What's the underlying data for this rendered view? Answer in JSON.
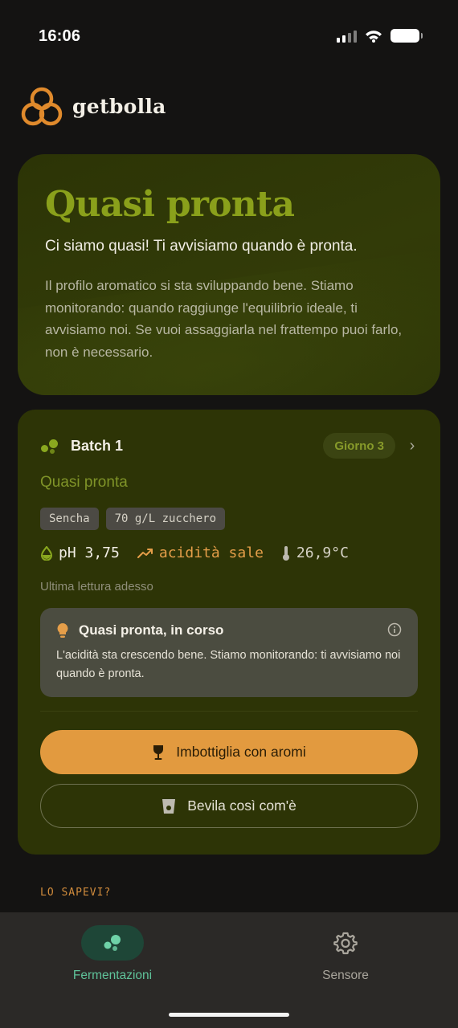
{
  "status_bar": {
    "time": "16:06"
  },
  "brand": {
    "name": "getbolla"
  },
  "hero": {
    "title": "Quasi pronta",
    "subtitle": "Ci siamo quasi! Ti avvisiamo quando è pronta.",
    "body": "Il profilo aromatico si sta sviluppando bene. Stiamo monitorando: quando raggiunge l'equilibrio ideale, ti avvisiamo noi. Se vuoi assaggiarla nel frattempo puoi farlo, non è necessario."
  },
  "batch": {
    "title": "Batch 1",
    "day": "Giorno 3",
    "status": "Quasi pronta",
    "chips": [
      "Sencha",
      "70 g/L zucchero"
    ],
    "readings": {
      "ph": "pH 3,75",
      "acidity": "acidità sale",
      "temperature": "26,9°C"
    },
    "last_reading": "Ultima lettura adesso",
    "insight": {
      "title": "Quasi pronta, in corso",
      "body": "L'acidità sta crescendo bene. Stiamo monitorando: ti avvisiamo noi quando è pronta."
    },
    "primary_action": "Imbottiglia con aromi",
    "secondary_action": "Bevila così com'è"
  },
  "did_you_know": "LO SAPEVI?",
  "tabs": [
    {
      "label": "Fermentazioni",
      "icon": "bubbles-icon",
      "active": true
    },
    {
      "label": "Sensore",
      "icon": "gear-icon",
      "active": false
    }
  ],
  "colors": {
    "accent_orange": "#e29a3f",
    "olive_title": "#8aa01b",
    "card_bg": "#2d3406",
    "active_tab": "#5fc39a"
  }
}
